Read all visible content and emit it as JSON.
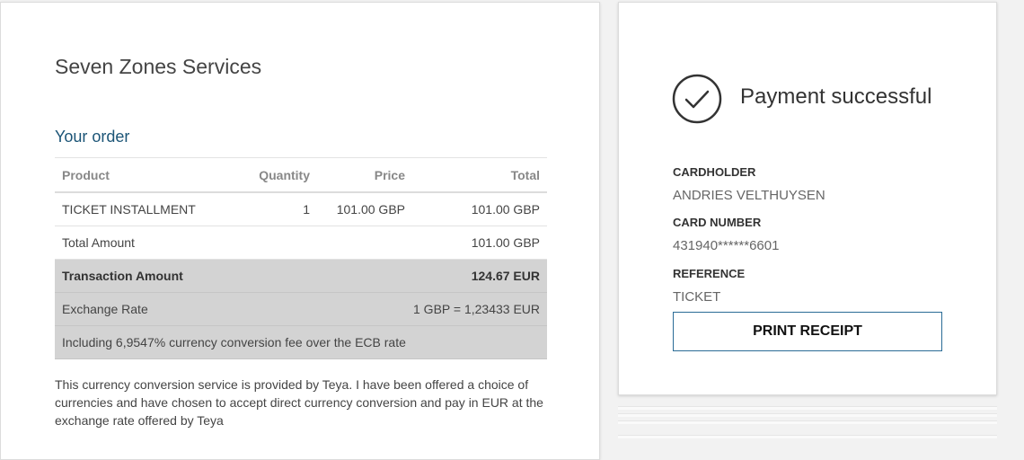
{
  "merchant_name": "Seven Zones Services",
  "order": {
    "title": "Your order",
    "headers": {
      "product": "Product",
      "quantity": "Quantity",
      "price": "Price",
      "total": "Total"
    },
    "items": [
      {
        "product": "TICKET INSTALLMENT",
        "quantity": "1",
        "price": "101.00 GBP",
        "total": "101.00 GBP"
      }
    ],
    "total_amount": {
      "label": "Total Amount",
      "value": "101.00 GBP"
    },
    "transaction_amount": {
      "label": "Transaction Amount",
      "value": "124.67 EUR"
    },
    "exchange_rate": {
      "label": "Exchange Rate",
      "value": "1 GBP = 1,23433 EUR"
    },
    "fee_note": "Including 6,9547% currency conversion fee over the ECB rate"
  },
  "disclaimer": "This currency conversion service is provided by Teya. I have been offered a choice of currencies and have chosen to accept direct currency conversion and pay in EUR at the exchange rate offered by Teya",
  "payment": {
    "status": "Payment successful",
    "cardholder_label": "CARDHOLDER",
    "cardholder": "ANDRIES VELTHUYSEN",
    "card_number_label": "CARD NUMBER",
    "card_number": "431940******6601",
    "reference_label": "REFERENCE",
    "reference": "TICKET",
    "print_button": "PRINT RECEIPT"
  },
  "colors": {
    "accent": "#1c5577",
    "button_border": "#2a6b96",
    "summary_bg": "#d3d3d3"
  },
  "icons": {
    "status": "checkmark-circle-icon"
  }
}
